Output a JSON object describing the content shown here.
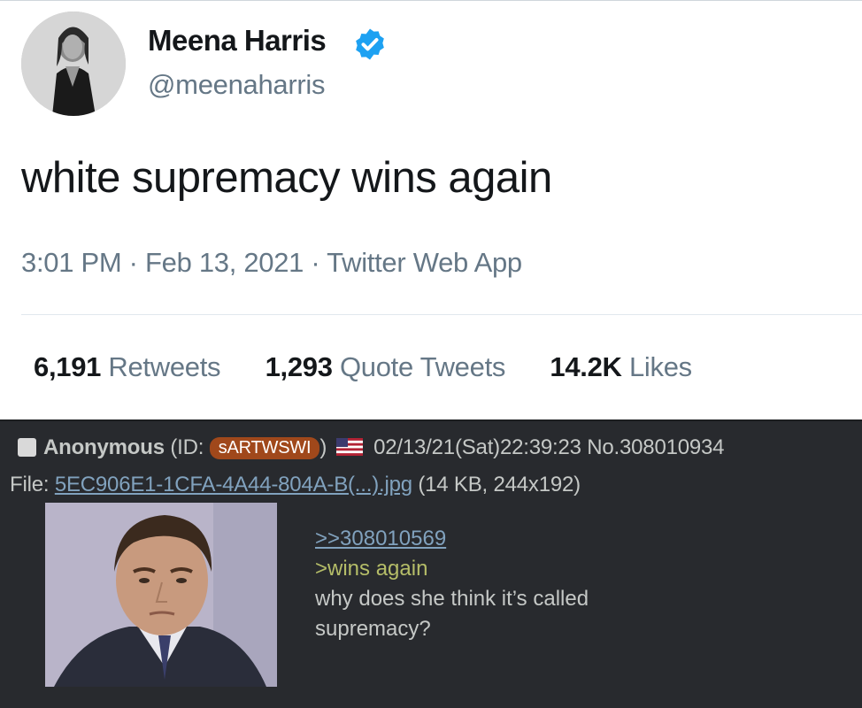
{
  "tweet": {
    "author_name": "Meena Harris",
    "handle": "@meenaharris",
    "text": "white supremacy wins again",
    "meta": "3:01 PM · Feb 13, 2021 · Twitter Web App",
    "stats": [
      {
        "count": "6,191",
        "label": "Retweets"
      },
      {
        "count": "1,293",
        "label": "Quote Tweets"
      },
      {
        "count": "14.2K",
        "label": "Likes"
      }
    ],
    "verified_color": "#1da1f2"
  },
  "post": {
    "name": "Anonymous",
    "id_open": "(ID:",
    "poster_id": "sARTWSWI",
    "id_close": ")",
    "datetime": "02/13/21(Sat)22:39:23",
    "post_no": "No.308010934",
    "file_prefix": "File:",
    "file_name": "5EC906E1-1CFA-4A44-804A-B(...).jpg",
    "file_info": "(14 KB, 244x192)",
    "quote_link": ">>308010569",
    "greentext": ">wins again",
    "comment": "why does she think it’s called supremacy?",
    "colors": {
      "background": "#282a2e",
      "link": "#81a2be",
      "greentext": "#b5bd68",
      "id_badge": "#a0481b"
    }
  }
}
